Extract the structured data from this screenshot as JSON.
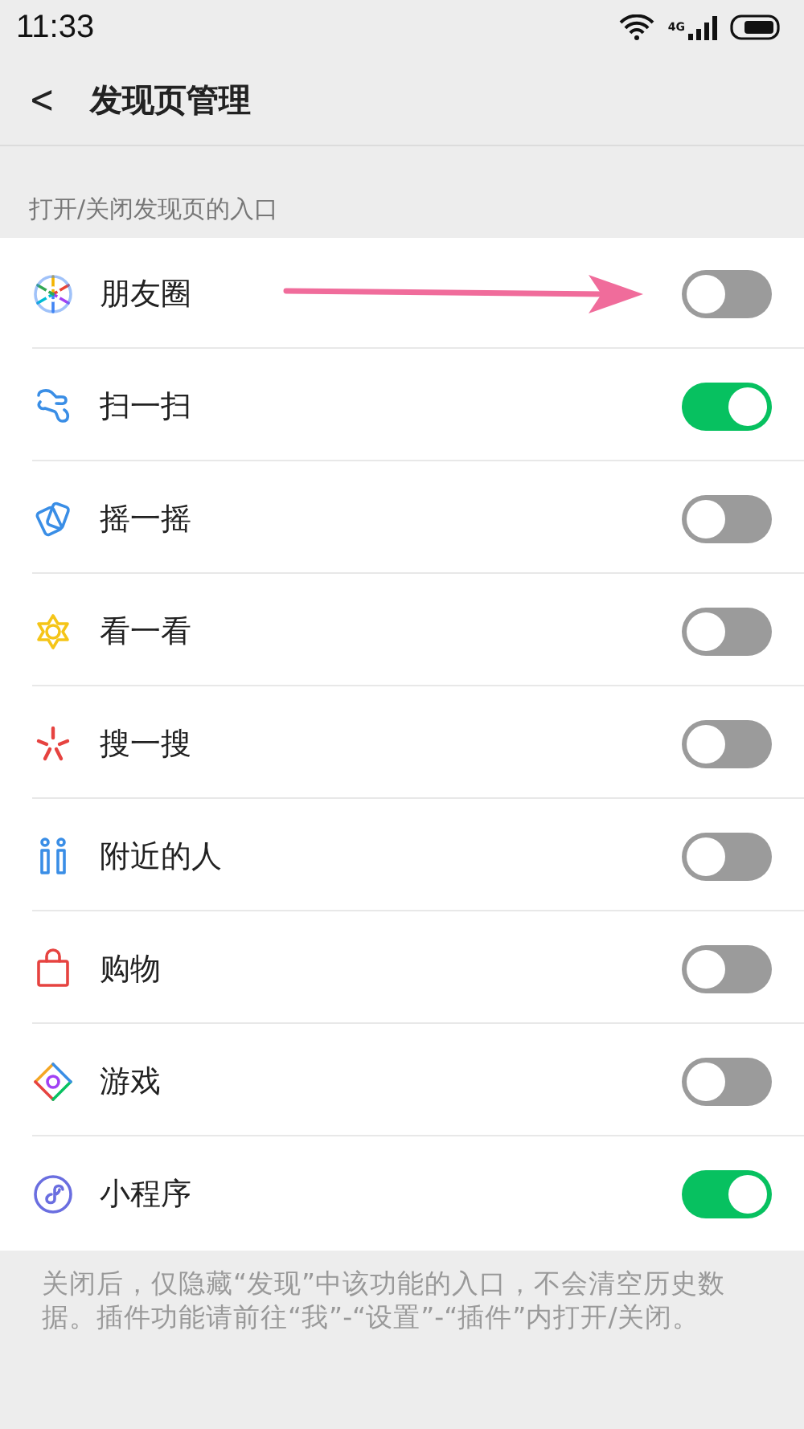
{
  "status_bar": {
    "time": "11:33",
    "network": "4G"
  },
  "header": {
    "back": "<",
    "title": "发现页管理"
  },
  "section_label": "打开/关闭发现页的入口",
  "items": [
    {
      "label": "朋友圈",
      "on": false
    },
    {
      "label": "扫一扫",
      "on": true
    },
    {
      "label": "摇一摇",
      "on": false
    },
    {
      "label": "看一看",
      "on": false
    },
    {
      "label": "搜一搜",
      "on": false
    },
    {
      "label": "附近的人",
      "on": false
    },
    {
      "label": "购物",
      "on": false
    },
    {
      "label": "游戏",
      "on": false
    },
    {
      "label": "小程序",
      "on": true
    }
  ],
  "footer_note": "关闭后，仅隐藏“发现”中该功能的入口，不会清空历史数据。插件功能请前往“我”-“设置”-“插件”内打开/关闭。"
}
